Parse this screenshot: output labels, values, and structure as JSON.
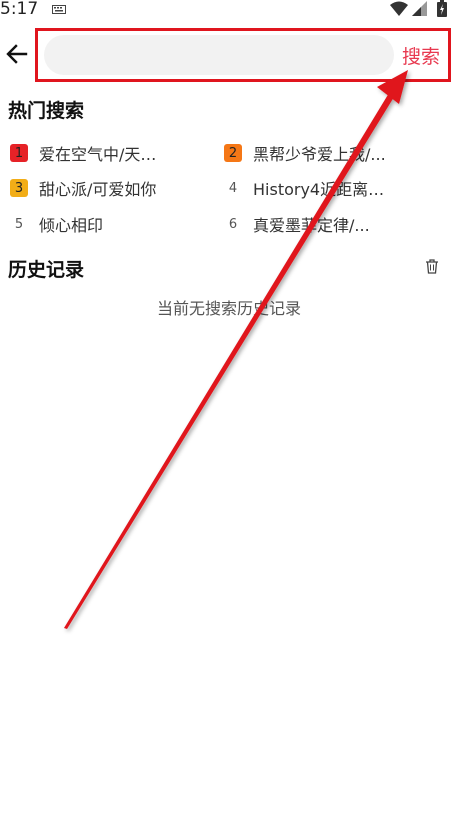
{
  "status_bar": {
    "time": "5:17"
  },
  "search": {
    "placeholder": "",
    "button_label": "搜索"
  },
  "hot_search": {
    "title": "热门搜索",
    "items": [
      {
        "rank": "1",
        "text": "爱在空气中/天…"
      },
      {
        "rank": "2",
        "text": "黑帮少爷爱上我/..."
      },
      {
        "rank": "3",
        "text": "甜心派/可爱如你"
      },
      {
        "rank": "4",
        "text": "History4近距离…"
      },
      {
        "rank": "5",
        "text": "倾心相印"
      },
      {
        "rank": "6",
        "text": "真爱墨菲定律/..."
      }
    ]
  },
  "history": {
    "title": "历史记录",
    "empty_text": "当前无搜索历史记录"
  },
  "colors": {
    "accent": "#e8384f",
    "annotation_red": "#e0151e"
  }
}
